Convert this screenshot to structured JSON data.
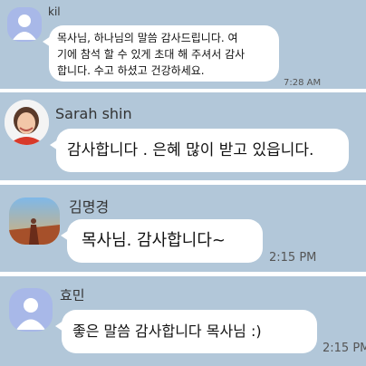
{
  "messages": [
    {
      "sender": "kil",
      "lines": [
        "목사님, 하나님의 말씀 감사드립니다. 여",
        "기에 참석 할 수 있게 초대 해 주셔서 감사",
        "합니다. 수고 하셨고 건강하세요."
      ],
      "time": "7:28 AM",
      "avatar": "default-person-icon"
    },
    {
      "sender": "Sarah shin",
      "text": "감사합니다 . 은혜 많이 받고 있읍니다.",
      "avatar": "profile-photo"
    },
    {
      "sender": "김명경",
      "text": "목사님. 감사합니다~",
      "time": "2:15 PM",
      "avatar": "profile-photo"
    },
    {
      "sender": "효민",
      "text": "좋은 말씀 감사합니다 목사님 :)",
      "time": "2:15 PM",
      "avatar": "default-person-icon"
    }
  ],
  "colors": {
    "chat_background": "#b2c7d9",
    "bubble": "#ffffff",
    "default_avatar": "#a8b8e8"
  }
}
